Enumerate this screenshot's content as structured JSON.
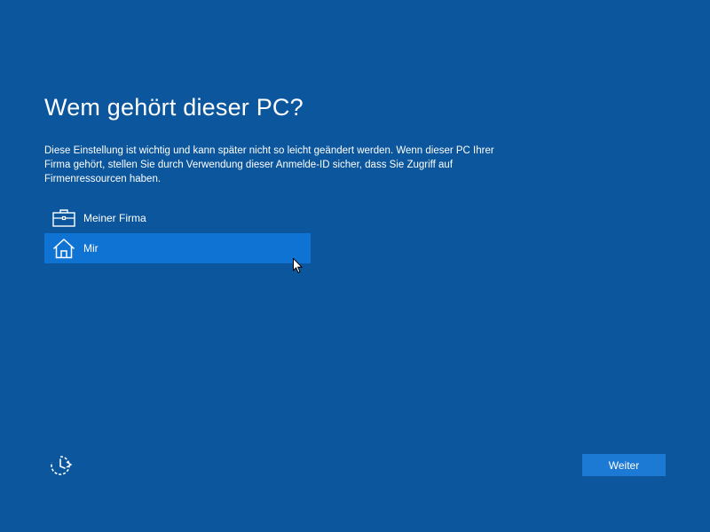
{
  "page": {
    "title": "Wem gehört dieser PC?",
    "description": "Diese Einstellung ist wichtig und kann später nicht so leicht geändert werden. Wenn dieser PC Ihrer Firma gehört, stellen Sie durch Verwendung dieser Anmelde-ID sicher, dass Sie Zugriff auf Firmenressourcen haben."
  },
  "options": [
    {
      "label": "Meiner Firma",
      "icon": "briefcase-icon",
      "selected": false
    },
    {
      "label": "Mir",
      "icon": "home-icon",
      "selected": true
    }
  ],
  "footer": {
    "next_label": "Weiter",
    "ease_of_access_icon": "ease-of-access-icon"
  },
  "colors": {
    "background": "#0b569c",
    "selected_option": "#0f73d3",
    "button": "#1c7ad5",
    "text": "#ffffff"
  }
}
